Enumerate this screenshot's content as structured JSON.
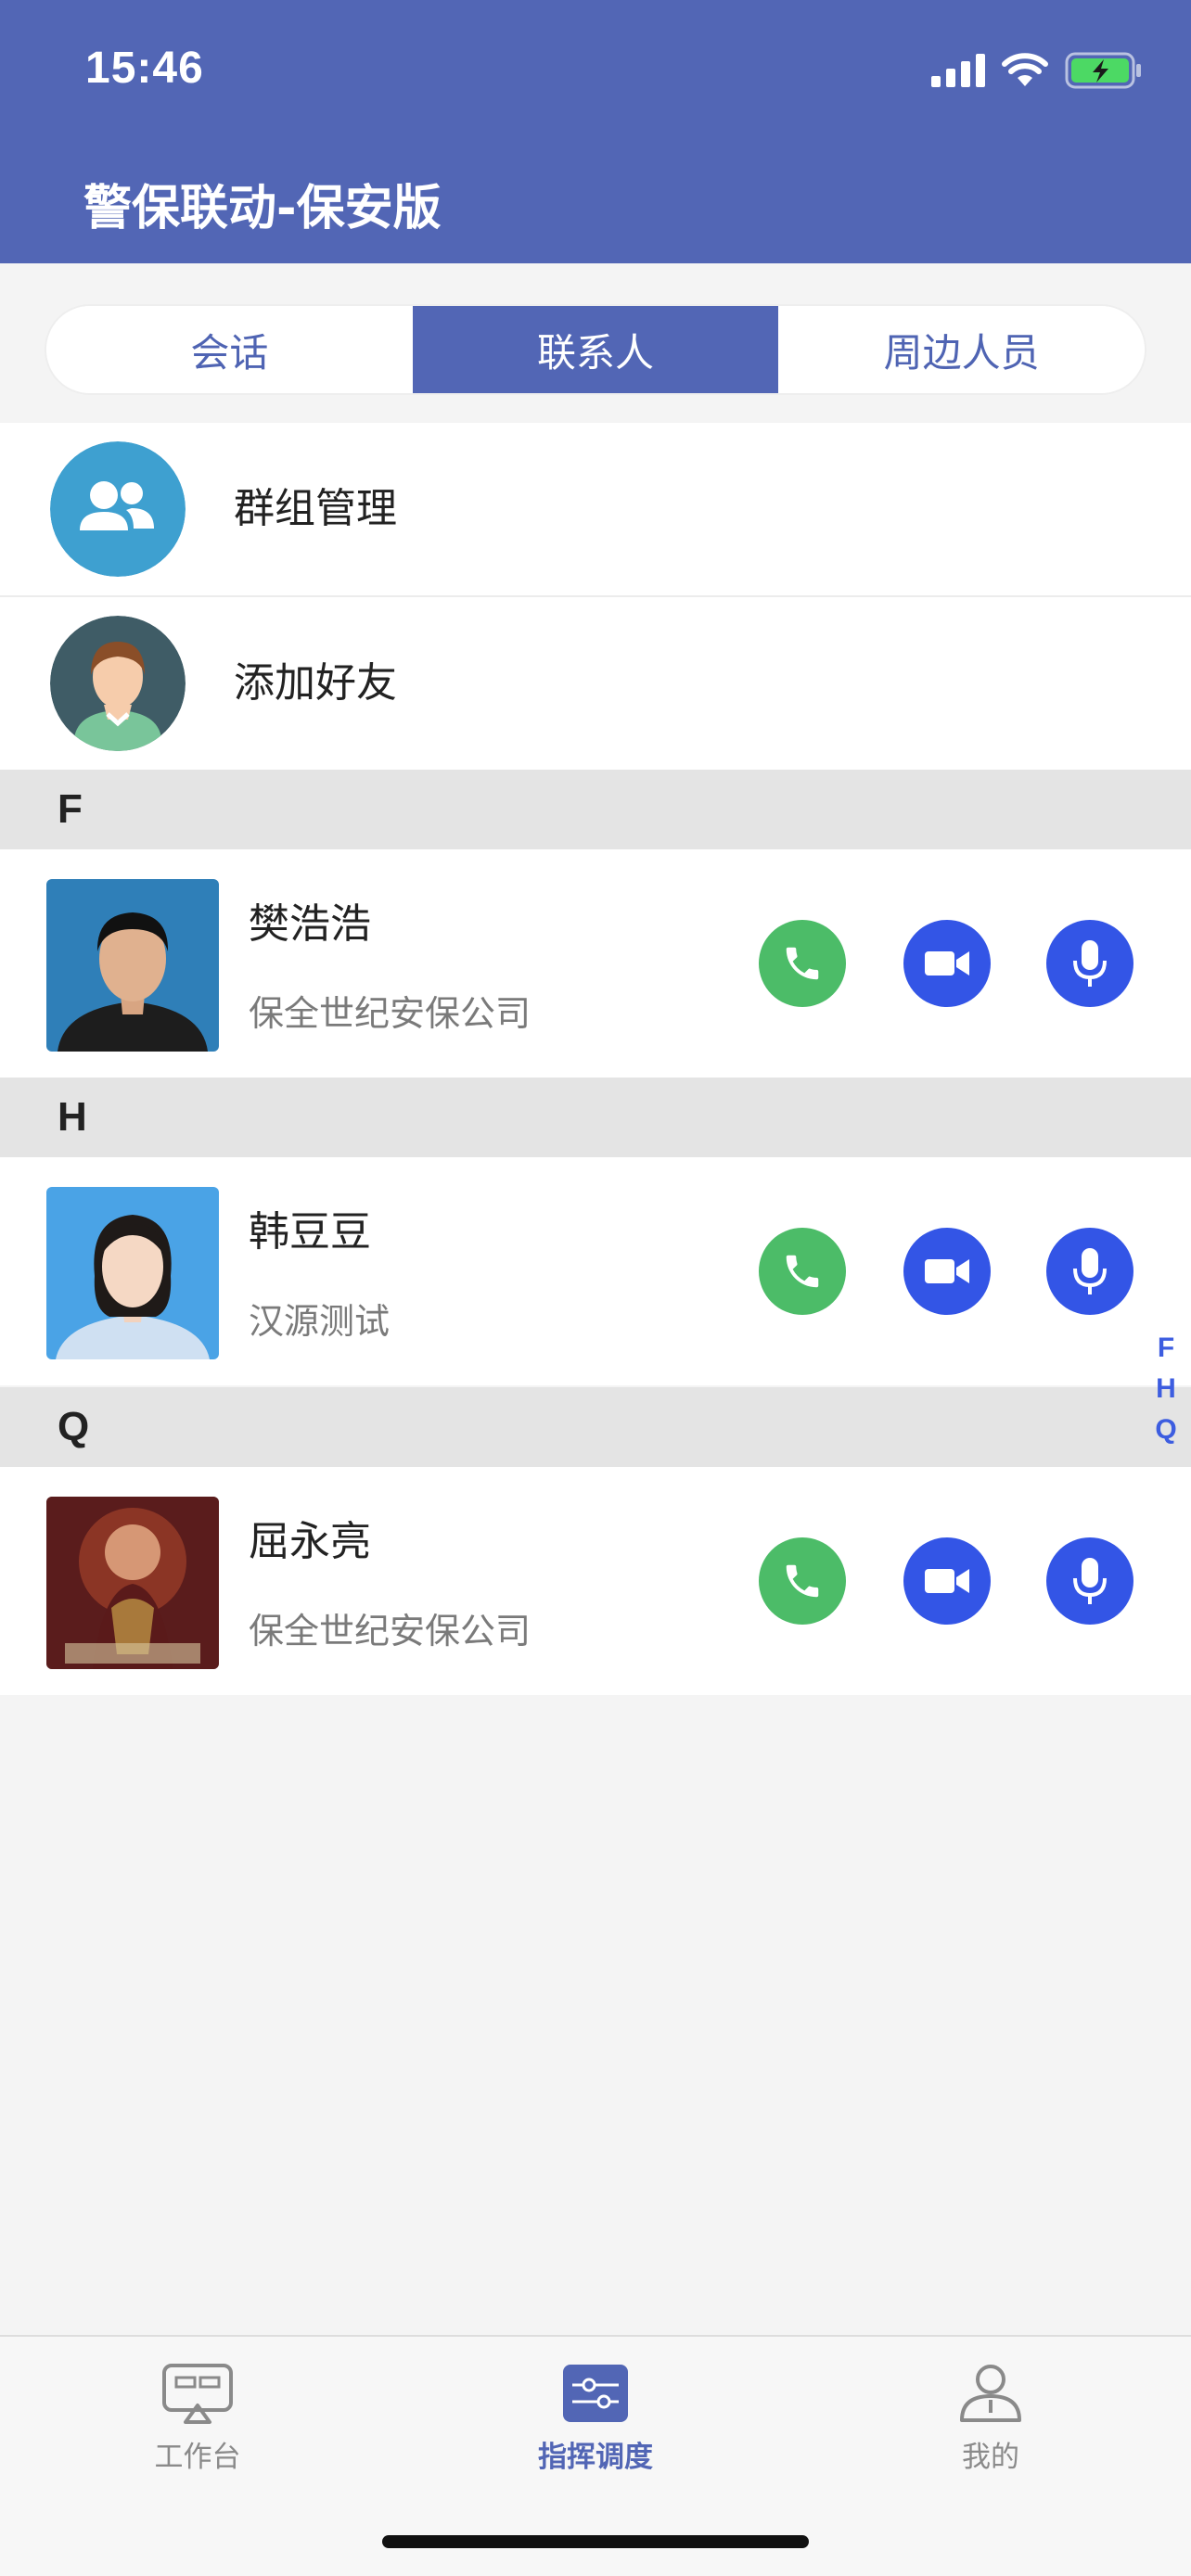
{
  "status_bar": {
    "time": "15:46"
  },
  "header": {
    "title": "警保联动-保安版"
  },
  "tabs": [
    {
      "label": "会话",
      "active": false
    },
    {
      "label": "联系人",
      "active": true
    },
    {
      "label": "周边人员",
      "active": false
    }
  ],
  "menu": [
    {
      "label": "群组管理",
      "icon": "group-icon"
    },
    {
      "label": "添加好友",
      "icon": "avatar-icon"
    }
  ],
  "sections": [
    {
      "letter": "F",
      "contacts": [
        {
          "name": "樊浩浩",
          "org": "保全世纪安保公司"
        }
      ]
    },
    {
      "letter": "H",
      "contacts": [
        {
          "name": "韩豆豆",
          "org": "汉源测试"
        }
      ]
    },
    {
      "letter": "Q",
      "contacts": [
        {
          "name": "屈永亮",
          "org": "保全世纪安保公司"
        }
      ]
    }
  ],
  "index_letters": [
    "F",
    "H",
    "Q"
  ],
  "bottom_nav": [
    {
      "label": "工作台",
      "icon": "workbench-icon",
      "active": false
    },
    {
      "label": "指挥调度",
      "icon": "dispatch-icon",
      "active": true
    },
    {
      "label": "我的",
      "icon": "profile-icon",
      "active": false
    }
  ],
  "colors": {
    "primary": "#5266b5",
    "call_green": "#4cbc68",
    "action_blue": "#3355e6",
    "index_blue": "#3d5de0"
  }
}
